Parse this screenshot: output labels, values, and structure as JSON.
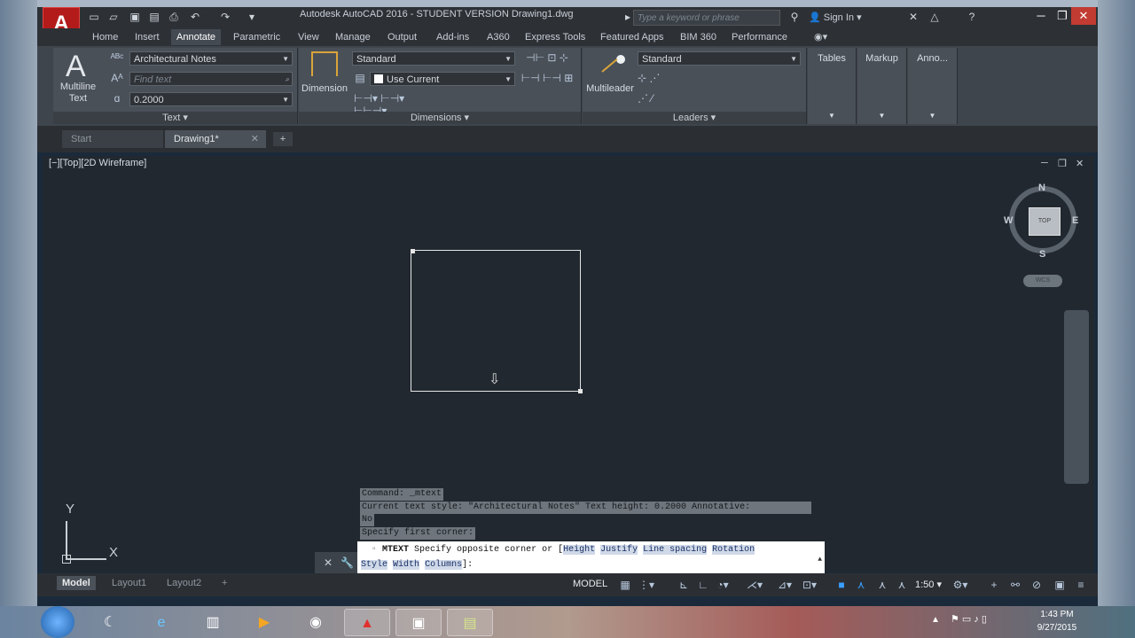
{
  "window": {
    "app_letter": "A",
    "title": "Autodesk AutoCAD 2016 - STUDENT VERSION    Drawing1.dwg",
    "search_placeholder": "Type a keyword or phrase",
    "sign_in": "Sign In",
    "help": "?"
  },
  "ribbon_tabs": [
    "Home",
    "Insert",
    "Annotate",
    "Parametric",
    "View",
    "Manage",
    "Output",
    "Add-ins",
    "A360",
    "Express Tools",
    "Featured Apps",
    "BIM 360",
    "Performance"
  ],
  "text_panel": {
    "big_button_line1": "Multiline",
    "big_button_line2": "Text",
    "style": "Architectural Notes",
    "find_placeholder": "Find text",
    "height": "0.2000",
    "label": "Text"
  },
  "dimensions_panel": {
    "dimension_button": "Dimension",
    "style": "Standard",
    "layer": "Use Current",
    "label": "Dimensions"
  },
  "leaders_panel": {
    "multileader_button": "Multileader",
    "style": "Standard",
    "label": "Leaders"
  },
  "extra_panels": [
    "Tables",
    "Markup",
    "Anno..."
  ],
  "file_tabs": [
    "Start",
    "Drawing1*"
  ],
  "viewport": {
    "label": "[−][Top][2D Wireframe]",
    "cube_face": "TOP",
    "compass": {
      "n": "N",
      "s": "S",
      "e": "E",
      "w": "W"
    },
    "wcs": "WCS"
  },
  "ucs": {
    "x": "X",
    "y": "Y"
  },
  "command": {
    "history": [
      "Command:  _mtext",
      "Current text style:  \"Architectural Notes\"  Text height:  0.2000  Annotative:",
      "No",
      "Specify first corner:"
    ],
    "prompt_cmd": "MTEXT",
    "prompt_text": "Specify opposite corner or [",
    "options_line1": [
      "Height",
      "Justify",
      "Line spacing",
      "Rotation"
    ],
    "options_line2": [
      "Style",
      "Width",
      "Columns"
    ],
    "prompt_end": "]:"
  },
  "layout_tabs": [
    "Model",
    "Layout1",
    "Layout2"
  ],
  "status": {
    "model": "MODEL",
    "scale": "1:50"
  },
  "clock": {
    "time": "1:43 PM",
    "date": "9/27/2015"
  }
}
